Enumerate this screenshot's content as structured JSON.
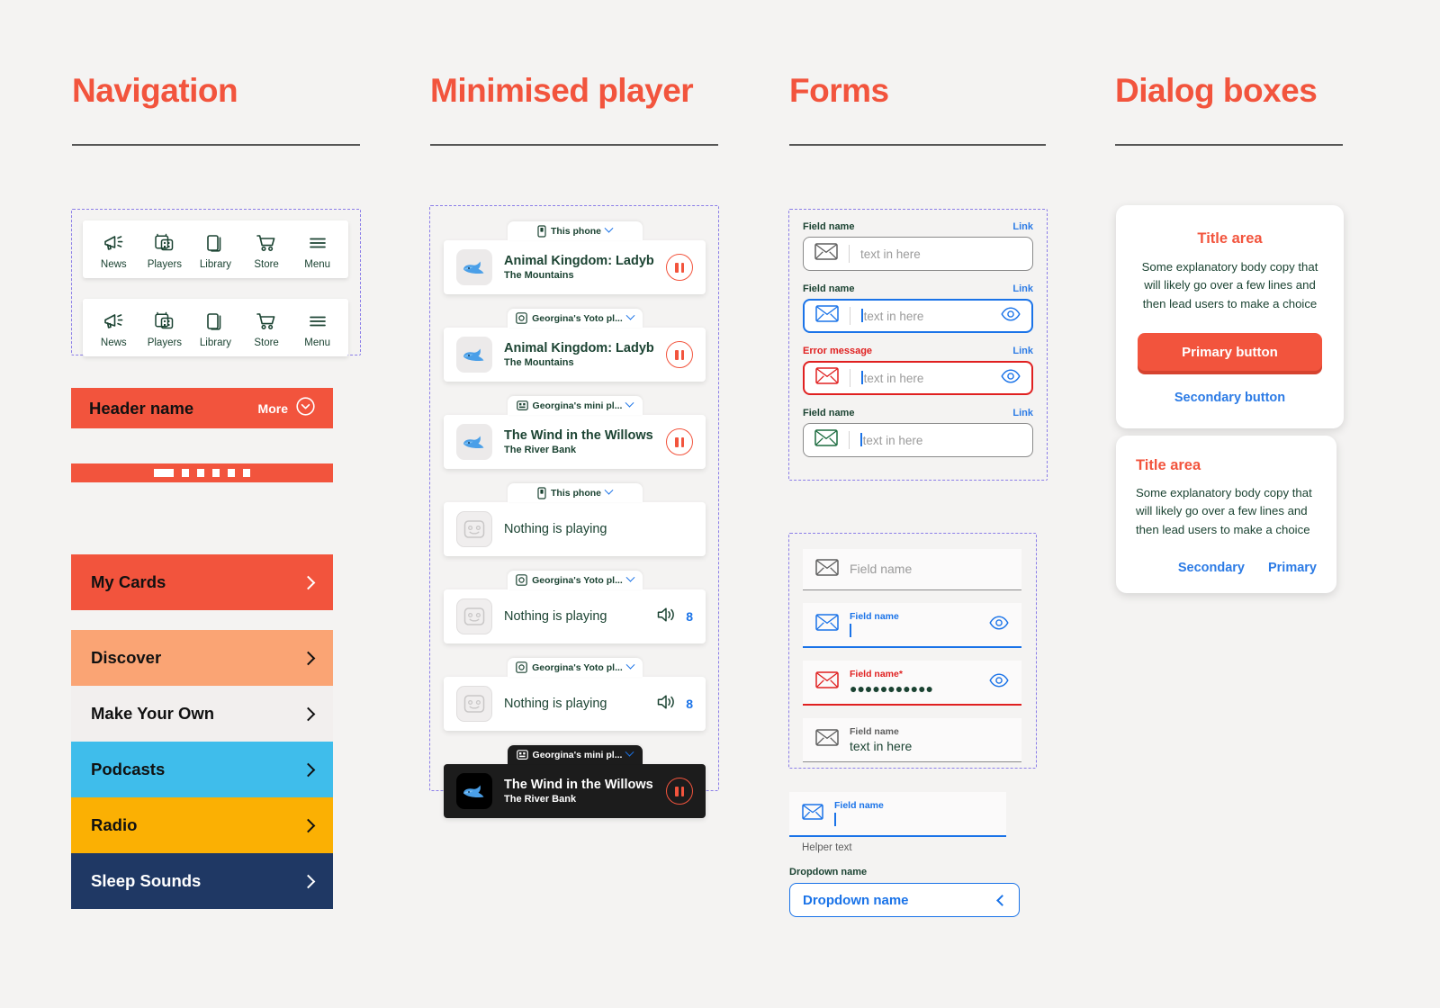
{
  "columns": [
    {
      "title": "Navigation"
    },
    {
      "title": "Minimised player"
    },
    {
      "title": "Forms"
    },
    {
      "title": "Dialog boxes"
    }
  ],
  "navigation": {
    "tabbars": [
      {
        "items": [
          {
            "label": "News",
            "icon": "megaphone-icon"
          },
          {
            "label": "Players",
            "icon": "player-device-icon"
          },
          {
            "label": "Library",
            "icon": "books-icon"
          },
          {
            "label": "Store",
            "icon": "cart-icon"
          },
          {
            "label": "Menu",
            "icon": "hamburger-icon"
          }
        ]
      },
      {
        "items": [
          {
            "label": "News",
            "icon": "megaphone-icon"
          },
          {
            "label": "Players",
            "icon": "player-device-icon"
          },
          {
            "label": "Library",
            "icon": "books-icon"
          },
          {
            "label": "Store",
            "icon": "cart-icon"
          },
          {
            "label": "Menu",
            "icon": "hamburger-icon"
          }
        ]
      }
    ],
    "header": {
      "name": "Header name",
      "more_label": "More"
    },
    "progress": {
      "filled_segments": 1,
      "total_segments": 6
    },
    "list": [
      {
        "label": "My Cards",
        "bg": "#f2543d",
        "text": "#111111",
        "chevron": "#ffffff"
      },
      {
        "label": "Discover",
        "bg": "#faa474",
        "text": "#111111",
        "chevron": "#111111"
      },
      {
        "label": "Make Your Own",
        "bg": "#f2efee",
        "text": "#111111",
        "chevron": "#111111"
      },
      {
        "label": "Podcasts",
        "bg": "#3fbdeb",
        "text": "#111111",
        "chevron": "#111111"
      },
      {
        "label": "Radio",
        "bg": "#fbb003",
        "text": "#111111",
        "chevron": "#111111"
      },
      {
        "label": "Sleep Sounds",
        "bg": "#1f3864",
        "text": "#ffffff",
        "chevron": "#ffffff"
      }
    ]
  },
  "player": {
    "cards": [
      {
        "device": "This phone",
        "device_icon": "phone-icon",
        "theme": "light",
        "state": "playing",
        "title": "Animal Kingdom: Ladybird Ad...",
        "subtitle": "The Mountains",
        "art": "whale-art",
        "control": "pause-button"
      },
      {
        "device": "Georgina's Yoto pl...",
        "device_icon": "yoto-player-icon",
        "theme": "light",
        "state": "playing",
        "title": "Animal Kingdom: Ladybird Ad...",
        "subtitle": "The Mountains",
        "art": "whale-art",
        "control": "pause-button"
      },
      {
        "device": "Georgina's mini pl...",
        "device_icon": "mini-player-icon",
        "theme": "light",
        "state": "playing",
        "title": "The Wind in the Willows",
        "subtitle": "The River Bank",
        "art": "whale-art",
        "control": "pause-button"
      },
      {
        "device": "This phone",
        "device_icon": "phone-icon",
        "theme": "light",
        "state": "empty",
        "title": "Nothing is playing",
        "subtitle": "",
        "art": "face-placeholder-art",
        "control": "none"
      },
      {
        "device": "Georgina's Yoto pl...",
        "device_icon": "yoto-player-icon",
        "theme": "light",
        "state": "empty",
        "title": "Nothing is playing",
        "subtitle": "",
        "art": "face-placeholder-art",
        "control": "volume",
        "volume": "8"
      },
      {
        "device": "Georgina's Yoto pl...",
        "device_icon": "yoto-player-icon",
        "theme": "light",
        "state": "empty",
        "title": "Nothing is playing",
        "subtitle": "",
        "art": "face-placeholder-art",
        "control": "volume",
        "volume": "8"
      },
      {
        "device": "Georgina's mini pl...",
        "device_icon": "mini-player-icon",
        "theme": "dark",
        "state": "playing",
        "title": "The Wind in the Willows",
        "subtitle": "The River Bank",
        "art": "whale-art",
        "control": "pause-button"
      }
    ]
  },
  "forms": {
    "outlined": [
      {
        "label": "Field name",
        "link": "Link",
        "value": "text in here",
        "state": "default",
        "icon_color": "#5e5e5e",
        "show_eye": false,
        "show_caret": false
      },
      {
        "label": "Field name",
        "link": "Link",
        "value": "text in here",
        "state": "focus",
        "icon_color": "#1a73e8",
        "show_eye": true,
        "show_caret": true
      },
      {
        "label": "Error message",
        "link": "Link",
        "value": "text in here",
        "state": "error",
        "icon_color": "#e02020",
        "show_eye": true,
        "show_caret": true
      },
      {
        "label": "Field name",
        "link": "Link",
        "value": "text in here",
        "state": "default",
        "icon_color": "#1b6b3f",
        "show_eye": false,
        "show_caret": true
      }
    ],
    "filled": [
      {
        "label": "Field name",
        "value": "",
        "state": "default",
        "label_color": "#9b9b9b",
        "value_color": "#9b9b9b",
        "icon_color": "#5e5e5e",
        "show_eye": false,
        "show_caret": false,
        "label_only": true
      },
      {
        "label": "Field name",
        "value": "",
        "state": "focus",
        "label_color": "#1a73e8",
        "value_color": "#1a73e8",
        "icon_color": "#1a73e8",
        "show_eye": true,
        "show_caret": true,
        "label_only": false
      },
      {
        "label": "Field name*",
        "value": "●●●●●●●●●●●",
        "state": "error",
        "label_color": "#e02020",
        "value_color": "#1b4332",
        "icon_color": "#e02020",
        "show_eye": true,
        "show_caret": false,
        "label_only": false
      },
      {
        "label": "Field name",
        "value": "text in here",
        "state": "default",
        "label_color": "#5e5e5e",
        "value_color": "#1b4332",
        "icon_color": "#5e5e5e",
        "show_eye": false,
        "show_caret": false,
        "label_only": false
      }
    ],
    "helper_field": {
      "label": "Field name",
      "value": "",
      "helper": "Helper text",
      "state": "focus"
    },
    "dropdown": {
      "label": "Dropdown name",
      "value": "Dropdown name",
      "chevron": "chevron-left-icon"
    }
  },
  "dialogs": [
    {
      "align": "center",
      "title": "Title area",
      "body": "Some explanatory body copy that will likely go over a few lines and then lead users to make a choice",
      "primary": "Primary button",
      "secondary": "Secondary button",
      "style": "stacked"
    },
    {
      "align": "left",
      "title": "Title area",
      "body": "Some explanatory body copy that will likely go over a few lines and then lead users to make a choice",
      "primary": "Primary",
      "secondary": "Secondary",
      "style": "inline"
    }
  ],
  "colors": {
    "coral": "#f2543d",
    "dark_green": "#1b4332",
    "blue": "#1a73e8",
    "link_blue": "#2c7be5",
    "error_red": "#e02020",
    "background": "#f4f3f2",
    "spec_purple": "#8b7ee8"
  }
}
